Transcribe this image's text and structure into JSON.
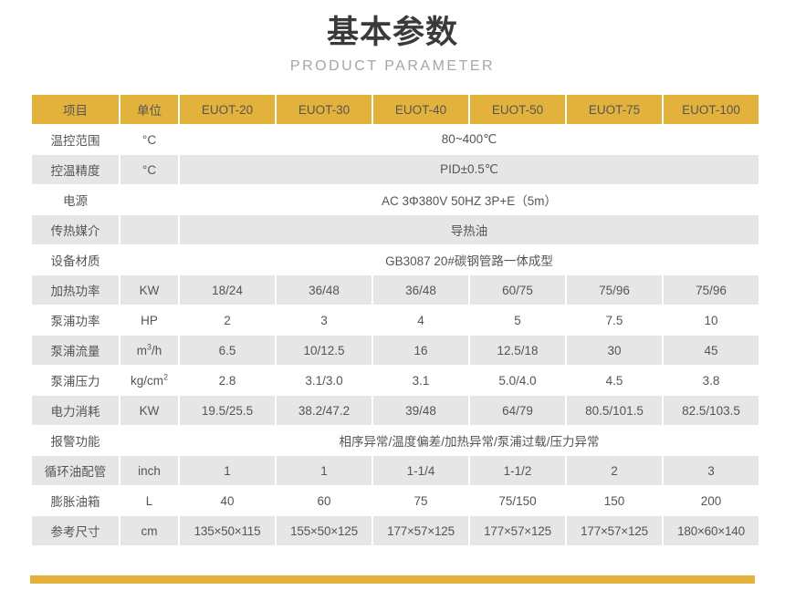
{
  "header": {
    "main_title": "基本参数",
    "sub_title": "PRODUCT PARAMETER"
  },
  "theme": {
    "accent_color": "#e3b23c",
    "stripe_color": "#e6e6e6",
    "text_color": "#555555",
    "title_color": "#3a3a3a",
    "subtitle_color": "#a6a6a6"
  },
  "table": {
    "columns": [
      {
        "key": "item",
        "label": "项目"
      },
      {
        "key": "unit",
        "label": "单位"
      },
      {
        "key": "m20",
        "label": "EUOT-20"
      },
      {
        "key": "m30",
        "label": "EUOT-30"
      },
      {
        "key": "m40",
        "label": "EUOT-40"
      },
      {
        "key": "m50",
        "label": "EUOT-50"
      },
      {
        "key": "m75",
        "label": "EUOT-75"
      },
      {
        "key": "m100",
        "label": "EUOT-100"
      }
    ],
    "rows": [
      {
        "item": "温控范围",
        "unit": "°C",
        "merged": true,
        "merged_value": "80~400℃",
        "values": []
      },
      {
        "item": "控温精度",
        "unit": "°C",
        "merged": true,
        "merged_value": "PID±0.5℃",
        "values": []
      },
      {
        "item": "电源",
        "unit": "",
        "merged": true,
        "merged_value": "AC 3Φ380V 50HZ  3P+E（5m）",
        "values": []
      },
      {
        "item": "传热媒介",
        "unit": "",
        "merged": true,
        "merged_value": "导热油",
        "values": []
      },
      {
        "item": "设备材质",
        "unit": "",
        "merged": true,
        "merged_value": "GB3087    20#碳钢管路一体成型",
        "values": []
      },
      {
        "item": "加热功率",
        "unit": "KW",
        "merged": false,
        "values": [
          "18/24",
          "36/48",
          "36/48",
          "60/75",
          "75/96",
          "75/96"
        ]
      },
      {
        "item": "泵浦功率",
        "unit": "HP",
        "merged": false,
        "values": [
          "2",
          "3",
          "4",
          "5",
          "7.5",
          "10"
        ]
      },
      {
        "item": "泵浦流量",
        "unit": "m³/h",
        "unit_base": "m",
        "unit_sup": "3",
        "unit_tail": "/h",
        "merged": false,
        "values": [
          "6.5",
          "10/12.5",
          "16",
          "12.5/18",
          "30",
          "45"
        ]
      },
      {
        "item": "泵浦压力",
        "unit": "kg/cm²",
        "unit_base": "kg/cm",
        "unit_sup": "2",
        "unit_tail": "",
        "merged": false,
        "values": [
          "2.8",
          "3.1/3.0",
          "3.1",
          "5.0/4.0",
          "4.5",
          "3.8"
        ]
      },
      {
        "item": "电力消耗",
        "unit": "KW",
        "merged": false,
        "values": [
          "19.5/25.5",
          "38.2/47.2",
          "39/48",
          "64/79",
          "80.5/101.5",
          "82.5/103.5"
        ]
      },
      {
        "item": "报警功能",
        "unit": "",
        "merged": true,
        "merged_value": "相序异常/温度偏差/加热异常/泵浦过载/压力异常",
        "values": []
      },
      {
        "item": "循环油配管",
        "unit": "inch",
        "merged": false,
        "values": [
          "1",
          "1",
          "1-1/4",
          "1-1/2",
          "2",
          "3"
        ]
      },
      {
        "item": "膨胀油箱",
        "unit": "L",
        "merged": false,
        "values": [
          "40",
          "60",
          "75",
          "75/150",
          "150",
          "200"
        ]
      },
      {
        "item": "参考尺寸",
        "unit": "cm",
        "merged": false,
        "is_dim": true,
        "values": [
          "135×50×115",
          "155×50×125",
          "177×57×125",
          "177×57×125",
          "177×57×125",
          "180×60×140"
        ]
      }
    ]
  }
}
